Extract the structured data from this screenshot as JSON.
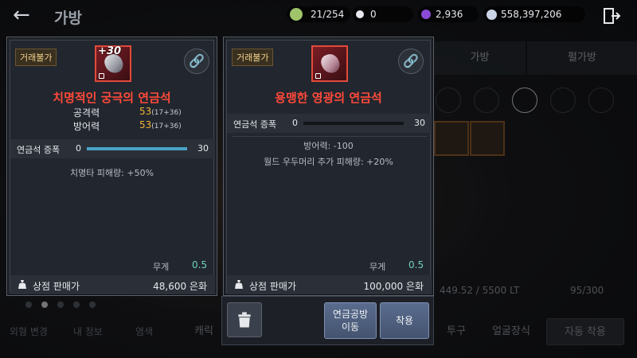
{
  "header": {
    "title": "가방",
    "currencies": [
      {
        "icon": "bag-capacity-icon",
        "value": "21/254",
        "color": "#9fc46a"
      },
      {
        "icon": "pearl-icon",
        "value": "0",
        "color": "#e8e8ee"
      },
      {
        "icon": "purple-gem-icon",
        "value": "2,936",
        "color": "#8a4ad8"
      },
      {
        "icon": "silver-coin-icon",
        "value": "558,397,206",
        "color": "#c9d4e6"
      }
    ]
  },
  "background": {
    "tabs": [
      "가방",
      "펄가방"
    ],
    "weight": "449.52 / 5500 LT",
    "slots": "95/300",
    "left_menu": [
      "외형 변경",
      "내 정보",
      "염색"
    ],
    "bottom_buttons": [
      "캐릭",
      "투구",
      "얼굴장식",
      "자동 착용"
    ]
  },
  "panels": [
    {
      "badge": "거래불가",
      "level": "+30",
      "name": "치명적인 궁극의 연금석",
      "name_color": "#ff4a3a",
      "stats": [
        {
          "label": "공격력",
          "value": "53",
          "detail": "(17+36)"
        },
        {
          "label": "방어력",
          "value": "53",
          "detail": "(17+36)"
        }
      ],
      "growth": {
        "label": "연금석 증폭",
        "min": "0",
        "max": "30",
        "progress": 1.0
      },
      "effects": [
        "치명타 피해량: +50%"
      ],
      "weight": {
        "label": "무게",
        "value": "0.5"
      },
      "shop": {
        "label": "상점 판매가",
        "value": "48,600 은화"
      }
    },
    {
      "badge": "거래불가",
      "name": "용맹한 영광의 연금석",
      "name_color": "#ff4a3a",
      "growth": {
        "label": "연금석 증폭",
        "min": "0",
        "max": "30",
        "progress": 0.0
      },
      "effects": [
        "방어력: -100",
        "월드 우두머리 추가 피해량: +20%"
      ],
      "weight": {
        "label": "무게",
        "value": "0.5"
      },
      "shop": {
        "label": "상점 판매가",
        "value": "100,000 은화"
      }
    }
  ],
  "actions": {
    "move_label": "연금공방\n이동",
    "equip_label": "착용"
  }
}
